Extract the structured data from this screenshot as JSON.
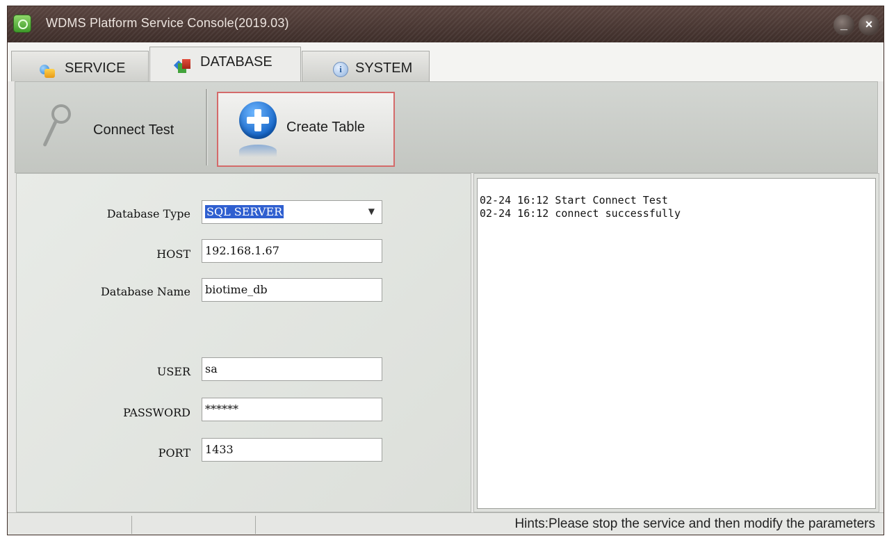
{
  "window": {
    "title": "WDMS Platform Service Console(2019.03)",
    "minimize_glyph": "_",
    "close_glyph": "×"
  },
  "tabs": [
    {
      "label": "SERVICE",
      "icon": "service-icon",
      "active": false
    },
    {
      "label": "DATABASE",
      "icon": "database-icon",
      "active": true
    },
    {
      "label": "SYSTEM",
      "icon": "info-icon",
      "active": false
    }
  ],
  "toolbar": {
    "connect_test": "Connect Test",
    "create_table": "Create Table"
  },
  "form": {
    "database_type": {
      "label": "Database Type",
      "value": "SQL SERVER"
    },
    "host": {
      "label": "HOST",
      "value": "192.168.1.67"
    },
    "database_name": {
      "label": "Database Name",
      "value": "biotime_db"
    },
    "user": {
      "label": "USER",
      "value": "sa"
    },
    "password": {
      "label": "PASSWORD",
      "value": "******"
    },
    "port": {
      "label": "PORT",
      "value": "1433"
    }
  },
  "log": [
    "02-24 16:12 Start Connect Test",
    "02-24 16:12 connect successfully"
  ],
  "status": {
    "hint": "Hints:Please stop the service and then modify the parameters"
  },
  "colors": {
    "titlebar": "#4a3833",
    "selection": "#2f5fd0",
    "active_button_border": "#d46a6a"
  }
}
